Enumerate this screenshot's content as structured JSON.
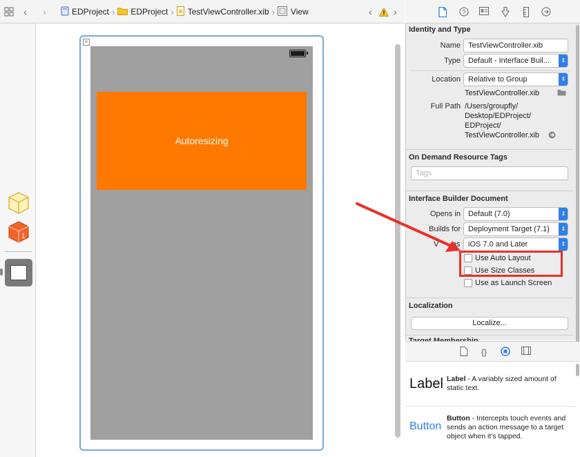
{
  "jumpbar": {
    "crumbs": [
      "EDProject",
      "EDProject",
      "TestViewController.xib",
      "View"
    ]
  },
  "canvas": {
    "orange_label": "Autoresizing",
    "colors": {
      "orange": "#ff7800",
      "screen": "#a0a0a0",
      "frame": "#7aa7d9"
    }
  },
  "inspector": {
    "identity": {
      "title": "Identity and Type",
      "name_label": "Name",
      "name_value": "TestViewController.xib",
      "type_label": "Type",
      "type_value": "Default - Interface Buil...",
      "location_label": "Location",
      "location_value": "Relative to Group",
      "location_file": "TestViewController.xib",
      "fullpath_label": "Full Path",
      "fullpath_lines": [
        "/Users/groupfly/",
        "Desktop/EDProject/",
        "EDProject/",
        "TestViewController.xib"
      ]
    },
    "ondemand": {
      "title": "On Demand Resource Tags",
      "tags_placeholder": "Tags"
    },
    "ibdoc": {
      "title": "Interface Builder Document",
      "opens_in_label": "Opens in",
      "opens_in_value": "Default (7.0)",
      "builds_for_label": "Builds for",
      "builds_for_value": "Deployment Target (7.1)",
      "view_as_label_fragment": "V",
      "view_as_label_tail": "as",
      "view_as_value": "iOS 7.0 and Later",
      "checks": [
        "Use Auto Layout",
        "Use Size Classes",
        "Use as Launch Screen"
      ]
    },
    "localization": {
      "title": "Localization",
      "button": "Localize..."
    },
    "target_membership_partial": "Target Membership"
  },
  "library": {
    "items": [
      {
        "big": "Label",
        "name": "Label",
        "desc": " - A variably sized amount of static text."
      },
      {
        "big": "Button",
        "name": "Button",
        "desc": " - Intercepts touch events and sends an action message to a target object when it's tapped."
      }
    ]
  },
  "annotation": {
    "color": "#e8302a"
  }
}
